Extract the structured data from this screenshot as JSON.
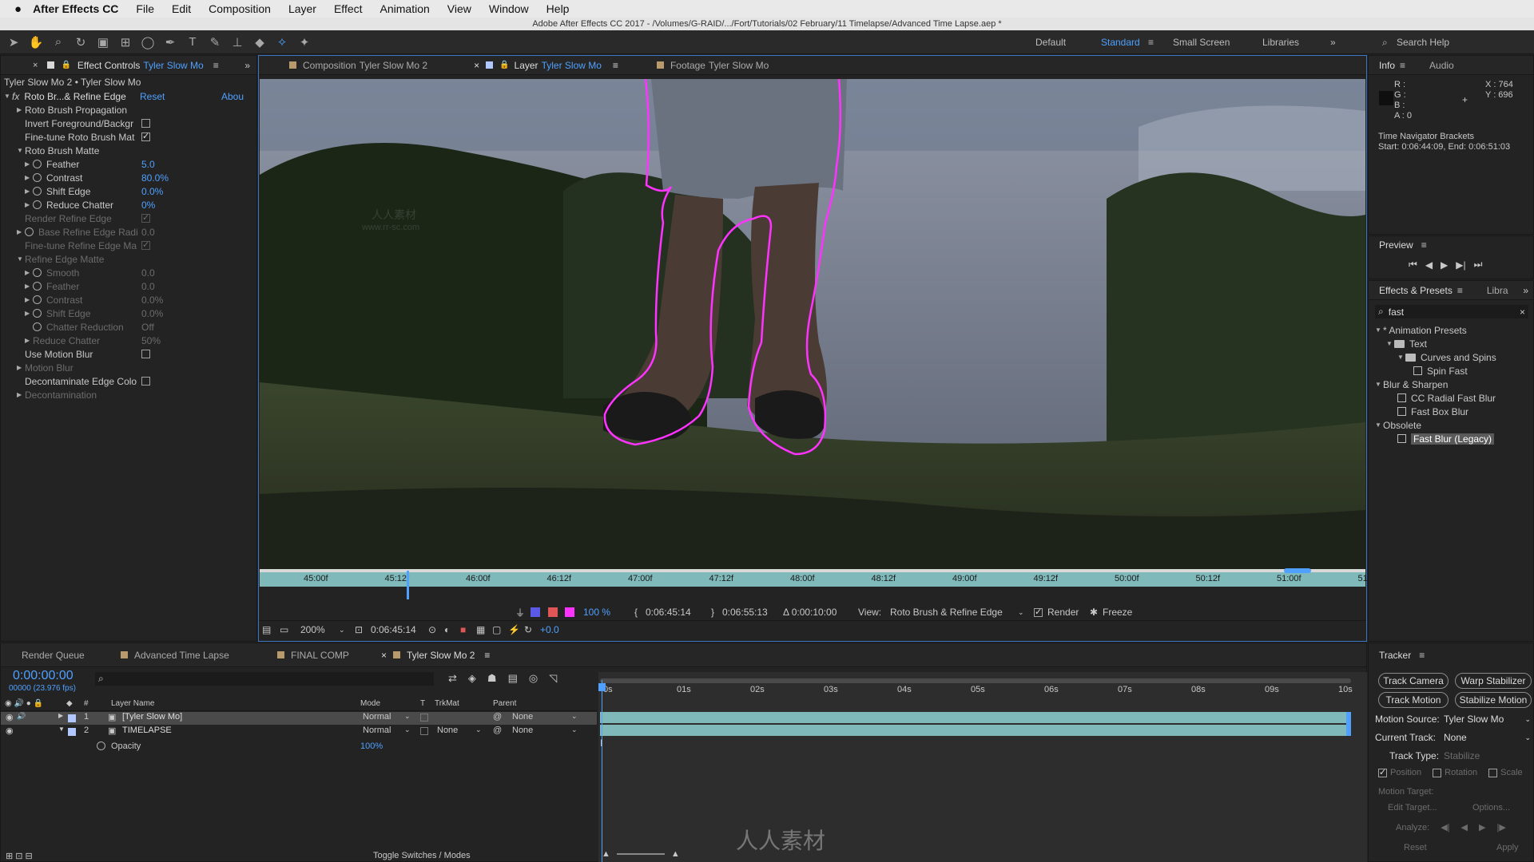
{
  "menubar": {
    "apple": "",
    "app": "After Effects CC",
    "items": [
      "File",
      "Edit",
      "Composition",
      "Layer",
      "Effect",
      "Animation",
      "View",
      "Window",
      "Help"
    ]
  },
  "window_title": "Adobe After Effects CC 2017 - /Volumes/G-RAID/.../Fort/Tutorials/02 February/11 Timelapse/Advanced Time Lapse.aep *",
  "toolbar": {
    "workspaces": [
      "Default",
      "Standard",
      "Small Screen",
      "Libraries"
    ],
    "search_help": "Search Help"
  },
  "effect_controls": {
    "tab_label": "Effect Controls",
    "tab_layer": "Tyler Slow Mo",
    "path": "Tyler Slow Mo 2 • Tyler Slow Mo",
    "effect_name": "Roto Br...& Refine Edge",
    "reset": "Reset",
    "about": "Abou",
    "rows": [
      {
        "label": "Roto Brush Propagation",
        "indent": 1,
        "tri": "▶"
      },
      {
        "label": "Invert Foreground/Backgr",
        "indent": 1,
        "check": false
      },
      {
        "label": "Fine-tune Roto Brush Mat",
        "indent": 1,
        "check": true
      },
      {
        "label": "Roto Brush Matte",
        "indent": 1,
        "tri": "▼"
      },
      {
        "label": "Feather",
        "indent": 2,
        "tri": "▶",
        "stop": true,
        "value": "5.0"
      },
      {
        "label": "Contrast",
        "indent": 2,
        "tri": "▶",
        "stop": true,
        "value": "80.0%"
      },
      {
        "label": "Shift Edge",
        "indent": 2,
        "tri": "▶",
        "stop": true,
        "value": "0.0%"
      },
      {
        "label": "Reduce Chatter",
        "indent": 2,
        "tri": "▶",
        "stop": true,
        "value": "0%"
      },
      {
        "label": "Render Refine Edge",
        "indent": 1,
        "check": true,
        "dim": true
      },
      {
        "label": "Base Refine Edge Radi",
        "indent": 1,
        "tri": "▶",
        "stop": true,
        "value": "0.0",
        "dim": true
      },
      {
        "label": "Fine-tune Refine Edge Ma",
        "indent": 1,
        "check": true,
        "dim": true
      },
      {
        "label": "Refine Edge Matte",
        "indent": 1,
        "tri": "▼",
        "dim": true
      },
      {
        "label": "Smooth",
        "indent": 2,
        "tri": "▶",
        "stop": true,
        "value": "0.0",
        "dim": true
      },
      {
        "label": "Feather",
        "indent": 2,
        "tri": "▶",
        "stop": true,
        "value": "0.0",
        "dim": true
      },
      {
        "label": "Contrast",
        "indent": 2,
        "tri": "▶",
        "stop": true,
        "value": "0.0%",
        "dim": true
      },
      {
        "label": "Shift Edge",
        "indent": 2,
        "tri": "▶",
        "stop": true,
        "value": "0.0%",
        "dim": true
      },
      {
        "label": "Chatter Reduction",
        "indent": 2,
        "stop": true,
        "value": "Off",
        "dim": true
      },
      {
        "label": "Reduce Chatter",
        "indent": 2,
        "tri": "▶",
        "value": "50%",
        "dim": true
      },
      {
        "label": "Use Motion Blur",
        "indent": 1,
        "check": false
      },
      {
        "label": "Motion Blur",
        "indent": 1,
        "tri": "▶",
        "dim": true
      },
      {
        "label": "Decontaminate Edge Colo",
        "indent": 1,
        "check": false
      },
      {
        "label": "Decontamination",
        "indent": 1,
        "tri": "▶",
        "dim": true
      }
    ]
  },
  "viewer": {
    "tabs": [
      {
        "label": "Composition",
        "name": "Tyler Slow Mo 2"
      },
      {
        "label": "Layer",
        "name": "Tyler Slow Mo"
      },
      {
        "label": "Footage",
        "name": "Tyler Slow Mo"
      }
    ],
    "ruler": [
      "45:00f",
      "45:12f",
      "46:00f",
      "46:12f",
      "47:00f",
      "47:12f",
      "48:00f",
      "48:12f",
      "49:00f",
      "49:12f",
      "50:00f",
      "50:12f",
      "51:00f",
      "51:"
    ],
    "opacity_value": "100 %",
    "in_time": "0:06:45:14",
    "out_time": "0:06:55:13",
    "duration": "Δ 0:00:10:00",
    "view_label": "View:",
    "view_value": "Roto Brush & Refine Edge",
    "render_label": "Render",
    "freeze_label": "Freeze",
    "zoom": "200%",
    "current_time": "0:06:45:14",
    "exposure": "+0.0"
  },
  "info": {
    "tabs": [
      "Info",
      "Audio"
    ],
    "r": "R :",
    "g": "G :",
    "b": "B :",
    "a": "A : 0",
    "x": "X : 764",
    "y": "Y : 696",
    "brackets_title": "Time Navigator Brackets",
    "brackets": "Start: 0:06:44:09, End: 0:06:51:03"
  },
  "preview": {
    "title": "Preview"
  },
  "effects_presets": {
    "tabs": [
      "Effects & Presets",
      "Libra"
    ],
    "search": "fast",
    "tree": [
      {
        "label": "* Animation Presets",
        "level": 0,
        "kind": "cat"
      },
      {
        "label": "Text",
        "level": 1,
        "kind": "folder"
      },
      {
        "label": "Curves and Spins",
        "level": 2,
        "kind": "folder"
      },
      {
        "label": "Spin Fast",
        "level": 3,
        "kind": "fx"
      },
      {
        "label": "Blur & Sharpen",
        "level": 0,
        "kind": "cat"
      },
      {
        "label": "CC Radial Fast Blur",
        "level": 2,
        "kind": "fx"
      },
      {
        "label": "Fast Box Blur",
        "level": 2,
        "kind": "fx"
      },
      {
        "label": "Obsolete",
        "level": 0,
        "kind": "cat"
      },
      {
        "label": "Fast Blur (Legacy)",
        "level": 2,
        "kind": "fx",
        "selected": true
      }
    ]
  },
  "timeline": {
    "tabs": [
      "Render Queue",
      "Advanced Time Lapse",
      "FINAL COMP",
      "Tyler Slow Mo 2"
    ],
    "tab_colors": [
      "",
      "#b89a6c",
      "#b89a6c",
      "#b89a6c"
    ],
    "timecode": "0:00:00:00",
    "fps": "00000 (23.976 fps)",
    "headers": {
      "layer_name": "Layer Name",
      "mode": "Mode",
      "t": "T",
      "trkmat": "TrkMat",
      "parent": "Parent"
    },
    "layers": [
      {
        "num": "1",
        "name": "[Tyler Slow Mo]",
        "mode": "Normal",
        "trkmat": "",
        "parent": "None",
        "color": "#b1c8ff",
        "selected": true
      },
      {
        "num": "2",
        "name": "TIMELAPSE",
        "mode": "Normal",
        "trkmat": "None",
        "parent": "None",
        "color": "#b1c8ff",
        "selected": false
      }
    ],
    "opacity": {
      "label": "Opacity",
      "value": "100%"
    },
    "ruler": [
      "0s",
      "01s",
      "02s",
      "03s",
      "04s",
      "05s",
      "06s",
      "07s",
      "08s",
      "09s",
      "10s"
    ],
    "toggle": "Toggle Switches / Modes"
  },
  "tracker": {
    "title": "Tracker",
    "buttons": [
      "Track Camera",
      "Warp Stabilizer",
      "Track Motion",
      "Stabilize Motion"
    ],
    "motion_source_label": "Motion Source:",
    "motion_source": "Tyler Slow Mo",
    "current_track_label": "Current Track:",
    "current_track": "None",
    "track_type_label": "Track Type:",
    "track_type": "Stabilize",
    "checks": [
      "Position",
      "Rotation",
      "Scale"
    ],
    "motion_target_label": "Motion Target:",
    "edit_target": "Edit Target...",
    "options": "Options...",
    "analyze_label": "Analyze:",
    "reset": "Reset",
    "apply": "Apply"
  },
  "watermarks": {
    "top": "www.rr-sc.com",
    "mid": "人人素材",
    "url": "www.rr-sc.com",
    "bottom": "人人素材"
  }
}
